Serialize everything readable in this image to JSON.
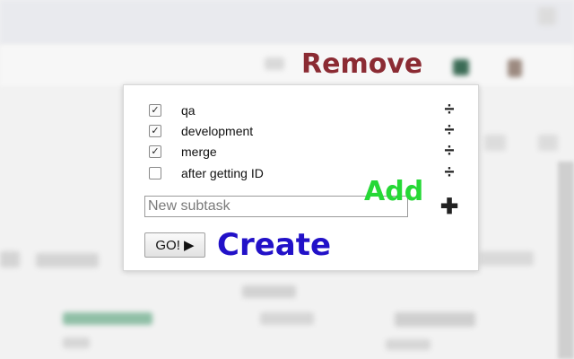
{
  "subtasks": [
    {
      "label": "qa",
      "checked": true
    },
    {
      "label": "development",
      "checked": true
    },
    {
      "label": "merge",
      "checked": true
    },
    {
      "label": "after getting ID",
      "checked": false
    }
  ],
  "icons": {
    "remove": "÷",
    "add": "✚",
    "check": "✓"
  },
  "new_subtask": {
    "placeholder": "New subtask",
    "value": ""
  },
  "go_button": {
    "label": "GO! ▶"
  },
  "annotations": {
    "remove": "Remove",
    "add": "Add",
    "create": "Create"
  },
  "colors": {
    "remove": "#8b2b33",
    "add": "#26d836",
    "create": "#2211c8"
  }
}
